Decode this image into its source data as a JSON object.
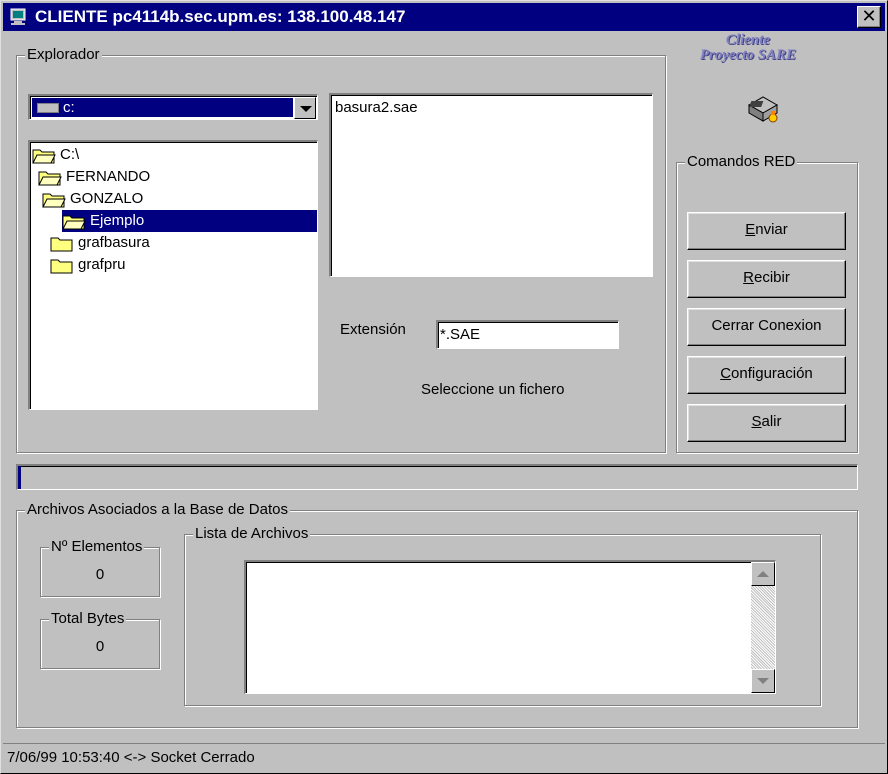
{
  "window": {
    "title": "CLIENTE pc4114b.sec.upm.es: 138.100.48.147",
    "close_label": "✕"
  },
  "explorador": {
    "legend": "Explorador",
    "drive": "c:",
    "tree": [
      {
        "label": "C:\\",
        "selected": false
      },
      {
        "label": "FERNANDO",
        "selected": false
      },
      {
        "label": "GONZALO",
        "selected": false
      },
      {
        "label": "Ejemplo",
        "selected": true
      },
      {
        "label": "grafbasura",
        "selected": false
      },
      {
        "label": "grafpru",
        "selected": false
      }
    ],
    "files": [
      "basura2.sae"
    ],
    "extension_label": "Extensión",
    "extension_value": "*.SAE",
    "hint": "Seleccione un fichero"
  },
  "logo": {
    "line1": "Cliente",
    "line2": "Proyecto SARE"
  },
  "comandos": {
    "legend": "Comandos RED",
    "buttons": [
      {
        "accel": "E",
        "rest": "nviar"
      },
      {
        "accel": "R",
        "rest": "ecibir"
      },
      {
        "accel": "",
        "rest": "Cerrar Conexion"
      },
      {
        "accel": "C",
        "rest": "onfiguración"
      },
      {
        "accel": "S",
        "rest": "alir"
      }
    ]
  },
  "progress": {
    "percent": 0.3
  },
  "archivos": {
    "legend": "Archivos Asociados a la Base de Datos",
    "elementos_label": "Nº Elementos",
    "elementos_value": "0",
    "bytes_label": "Total Bytes",
    "bytes_value": "0",
    "lista_label": "Lista de Archivos"
  },
  "statusbar": {
    "text": "7/06/99 10:53:40 <-> Socket Cerrado"
  },
  "colors": {
    "title_bg": "#000080",
    "face": "#c0c0c0",
    "selection": "#000080"
  }
}
